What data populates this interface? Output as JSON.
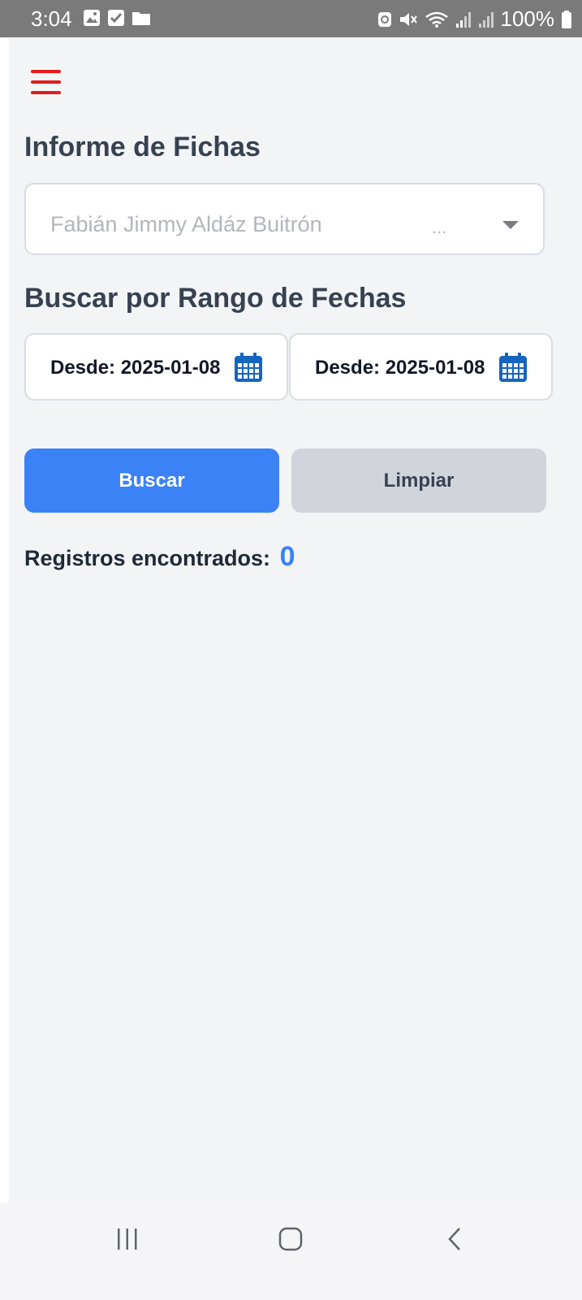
{
  "status_bar": {
    "time": "3:04",
    "battery": "100%",
    "left_icons": [
      "image-icon",
      "checkbox-icon",
      "folder-icon"
    ],
    "right_icons": [
      "data-saver-icon",
      "mute-icon",
      "wifi-icon",
      "signal-icon",
      "signal-icon",
      "battery-icon"
    ]
  },
  "header": {
    "menu_icon": "hamburger-menu-icon",
    "menu_color": "#e11d1d"
  },
  "report": {
    "title": "Informe de Fichas",
    "selector": {
      "value": "Fabián Jimmy Aldáz Buitrón",
      "ellipsis": "..."
    }
  },
  "date_range": {
    "title": "Buscar por Rango de Fechas",
    "from_text": "Desde: 2025-01-08",
    "to_text": "Desde: 2025-01-08",
    "icon": "calendar-icon",
    "icon_color": "#1565c0"
  },
  "actions": {
    "search_label": "Buscar",
    "clear_label": "Limpiar",
    "search_color": "#3b82f6",
    "clear_color": "#d1d5db"
  },
  "results": {
    "label": "Registros encontrados:",
    "count": "0"
  },
  "nav_bar": {
    "icons": [
      "recent-apps-icon",
      "home-icon",
      "back-icon"
    ]
  }
}
